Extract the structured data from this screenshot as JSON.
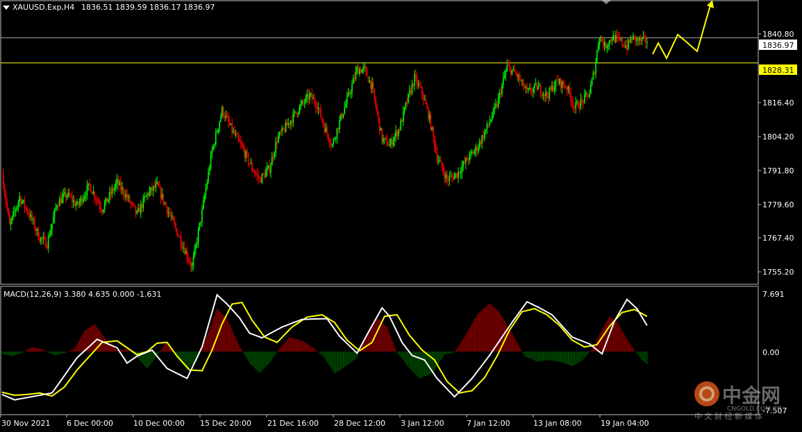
{
  "colors": {
    "background": "#000000",
    "frame": "#c0c0c0",
    "bull": "#00ff00",
    "bear": "#ff0000",
    "macd_line": "#ffffff",
    "signal_line": "#ffff00",
    "hist_pos": "#b40000",
    "hist_neg": "#006400",
    "current_price_line": "#a0a0a0",
    "level_line": "#ffff00",
    "forecast_arrow": "#ffff00"
  },
  "header": {
    "title": "XAUUSD.Exp,H4",
    "ohlc": "1836.51 1839.59 1836.17 1836.97"
  },
  "price_axis": {
    "ticks": [
      "1840.80",
      "1828.31",
      "1816.40",
      "1804.20",
      "1791.80",
      "1779.60",
      "1767.40",
      "1755.20"
    ],
    "current_price_label": "1836.97",
    "level_label": "1828.31"
  },
  "macd": {
    "label": "MACD(12,26,9) 3.380 4.635 0.000 -1.631",
    "axis_ticks": [
      "7.691",
      "0.00",
      "-7.507"
    ]
  },
  "time_axis": {
    "labels": [
      "30 Nov 2021",
      "6 Dec 00:00",
      "10 Dec 00:00",
      "15 Dec 20:00",
      "21 Dec 16:00",
      "28 Dec 12:00",
      "3 Jan 12:00",
      "7 Jan 12:00",
      "13 Jan 08:00",
      "19 Jan 04:00"
    ]
  },
  "watermark": {
    "brand": "中金网",
    "domain": "CNGOLD.COM.CN",
    "tagline": "中 文 财 经 新 媒 体"
  },
  "chart_data": [
    {
      "type": "candlestick",
      "title": "XAUUSD.Exp,H4",
      "ylim": [
        1752.0,
        1850.0
      ],
      "current_price": 1836.97,
      "horizontal_level": 1828.31,
      "anchors": [
        [
          0,
          1790
        ],
        [
          6,
          1772
        ],
        [
          14,
          1782
        ],
        [
          22,
          1776
        ],
        [
          30,
          1768
        ],
        [
          36,
          1766
        ],
        [
          44,
          1780
        ],
        [
          52,
          1783
        ],
        [
          60,
          1779
        ],
        [
          70,
          1786
        ],
        [
          80,
          1778
        ],
        [
          92,
          1787
        ],
        [
          100,
          1782
        ],
        [
          108,
          1776
        ],
        [
          116,
          1783
        ],
        [
          124,
          1786
        ],
        [
          132,
          1778
        ],
        [
          140,
          1770
        ],
        [
          146,
          1764
        ],
        [
          152,
          1758
        ],
        [
          160,
          1777
        ],
        [
          168,
          1798
        ],
        [
          176,
          1812
        ],
        [
          184,
          1805
        ],
        [
          192,
          1799
        ],
        [
          200,
          1792
        ],
        [
          206,
          1788
        ],
        [
          214,
          1792
        ],
        [
          220,
          1802
        ],
        [
          230,
          1808
        ],
        [
          238,
          1813
        ],
        [
          246,
          1817
        ],
        [
          252,
          1814
        ],
        [
          258,
          1806
        ],
        [
          264,
          1800
        ],
        [
          270,
          1808
        ],
        [
          278,
          1818
        ],
        [
          284,
          1826
        ],
        [
          290,
          1826
        ],
        [
          296,
          1820
        ],
        [
          304,
          1802
        ],
        [
          310,
          1800
        ],
        [
          318,
          1806
        ],
        [
          324,
          1815
        ],
        [
          330,
          1823
        ],
        [
          336,
          1818
        ],
        [
          342,
          1809
        ],
        [
          348,
          1796
        ],
        [
          356,
          1788
        ],
        [
          364,
          1790
        ],
        [
          372,
          1795
        ],
        [
          380,
          1799
        ],
        [
          388,
          1806
        ],
        [
          396,
          1814
        ],
        [
          404,
          1827
        ],
        [
          412,
          1824
        ],
        [
          420,
          1818
        ],
        [
          428,
          1820
        ],
        [
          436,
          1817
        ],
        [
          444,
          1822
        ],
        [
          452,
          1820
        ],
        [
          458,
          1813
        ],
        [
          464,
          1815
        ],
        [
          470,
          1818
        ],
        [
          474,
          1826
        ],
        [
          478,
          1838
        ],
        [
          482,
          1834
        ],
        [
          488,
          1837
        ],
        [
          494,
          1836
        ],
        [
          500,
          1834
        ],
        [
          504,
          1837
        ],
        [
          510,
          1836
        ]
      ]
    },
    {
      "type": "line",
      "title": "MACD(12,26,9)",
      "values_shown": [
        3.38,
        4.635,
        0.0,
        -1.631
      ],
      "ylim": [
        -7.507,
        7.691
      ],
      "series": [
        {
          "name": "MACD",
          "anchors": [
            [
              0,
              -5.6
            ],
            [
              10,
              -6.3
            ],
            [
              20,
              -6.0
            ],
            [
              40,
              -5.4
            ],
            [
              60,
              -0.8
            ],
            [
              76,
              1.6
            ],
            [
              92,
              0.5
            ],
            [
              100,
              -1.5
            ],
            [
              108,
              -0.6
            ],
            [
              120,
              0.2
            ],
            [
              132,
              -2.2
            ],
            [
              148,
              -3.5
            ],
            [
              160,
              0.6
            ],
            [
              172,
              7.4
            ],
            [
              180,
              6.2
            ],
            [
              190,
              4.4
            ],
            [
              198,
              2.4
            ],
            [
              208,
              1.8
            ],
            [
              224,
              3.2
            ],
            [
              240,
              4.2
            ],
            [
              260,
              4.3
            ],
            [
              270,
              2.0
            ],
            [
              284,
              -0.2
            ],
            [
              294,
              2.8
            ],
            [
              304,
              5.7
            ],
            [
              310,
              4.6
            ],
            [
              320,
              1.2
            ],
            [
              328,
              -0.5
            ],
            [
              338,
              -1.1
            ],
            [
              348,
              -3.5
            ],
            [
              362,
              -5.9
            ],
            [
              376,
              -3.5
            ],
            [
              390,
              -0.5
            ],
            [
              408,
              3.8
            ],
            [
              420,
              6.5
            ],
            [
              430,
              5.7
            ],
            [
              440,
              4.8
            ],
            [
              456,
              1.9
            ],
            [
              470,
              1.0
            ],
            [
              480,
              -0.3
            ],
            [
              490,
              4.0
            ],
            [
              500,
              6.8
            ],
            [
              508,
              5.6
            ],
            [
              516,
              3.4
            ]
          ]
        },
        {
          "name": "Signal",
          "anchors": [
            [
              0,
              -5.3
            ],
            [
              10,
              -5.7
            ],
            [
              20,
              -5.6
            ],
            [
              30,
              -5.4
            ],
            [
              40,
              -5.8
            ],
            [
              50,
              -4.6
            ],
            [
              60,
              -2.4
            ],
            [
              70,
              -0.6
            ],
            [
              80,
              1.2
            ],
            [
              92,
              1.4
            ],
            [
              100,
              0.5
            ],
            [
              108,
              -0.4
            ],
            [
              116,
              0.0
            ],
            [
              124,
              1.1
            ],
            [
              132,
              1.2
            ],
            [
              140,
              -0.6
            ],
            [
              150,
              -2.4
            ],
            [
              160,
              -2.5
            ],
            [
              168,
              0.2
            ],
            [
              176,
              3.6
            ],
            [
              184,
              6.2
            ],
            [
              192,
              6.4
            ],
            [
              200,
              4.1
            ],
            [
              210,
              1.9
            ],
            [
              220,
              1.2
            ],
            [
              232,
              3.2
            ],
            [
              244,
              4.5
            ],
            [
              256,
              4.8
            ],
            [
              266,
              3.8
            ],
            [
              276,
              1.5
            ],
            [
              286,
              0.1
            ],
            [
              296,
              1.2
            ],
            [
              306,
              4.6
            ],
            [
              316,
              4.8
            ],
            [
              326,
              2.1
            ],
            [
              336,
              0.2
            ],
            [
              346,
              -1.1
            ],
            [
              356,
              -3.9
            ],
            [
              366,
              -5.4
            ],
            [
              376,
              -5.1
            ],
            [
              386,
              -3.4
            ],
            [
              396,
              -0.6
            ],
            [
              406,
              2.8
            ],
            [
              416,
              5.2
            ],
            [
              426,
              5.6
            ],
            [
              436,
              4.8
            ],
            [
              446,
              3.4
            ],
            [
              456,
              1.5
            ],
            [
              466,
              0.6
            ],
            [
              476,
              0.9
            ],
            [
              486,
              3.3
            ],
            [
              496,
              5.1
            ],
            [
              506,
              5.5
            ],
            [
              516,
              4.6
            ]
          ]
        }
      ],
      "histogram_anchors": [
        [
          0,
          -0.3
        ],
        [
          8,
          -0.6
        ],
        [
          16,
          -0.2
        ],
        [
          24,
          0.6
        ],
        [
          32,
          0.3
        ],
        [
          42,
          -0.5
        ],
        [
          50,
          -0.2
        ],
        [
          58,
          0.4
        ],
        [
          66,
          2.7
        ],
        [
          74,
          3.6
        ],
        [
          84,
          1.4
        ],
        [
          92,
          0.2
        ],
        [
          100,
          0.3
        ],
        [
          108,
          -0.7
        ],
        [
          116,
          -2.2
        ],
        [
          124,
          -0.6
        ],
        [
          132,
          1.4
        ],
        [
          140,
          -0.8
        ],
        [
          148,
          -2.4
        ],
        [
          156,
          -1.2
        ],
        [
          164,
          2.1
        ],
        [
          172,
          5.6
        ],
        [
          180,
          4.3
        ],
        [
          190,
          0.7
        ],
        [
          198,
          -1.5
        ],
        [
          206,
          -2.8
        ],
        [
          214,
          -1.5
        ],
        [
          222,
          0.4
        ],
        [
          230,
          1.9
        ],
        [
          240,
          1.4
        ],
        [
          250,
          0.4
        ],
        [
          258,
          -0.8
        ],
        [
          266,
          -2.9
        ],
        [
          276,
          -1.8
        ],
        [
          284,
          -0.8
        ],
        [
          292,
          2.4
        ],
        [
          300,
          4.5
        ],
        [
          308,
          3.2
        ],
        [
          316,
          -0.1
        ],
        [
          326,
          -2.2
        ],
        [
          334,
          -3.5
        ],
        [
          344,
          -2.9
        ],
        [
          354,
          -0.4
        ],
        [
          362,
          -0.1
        ],
        [
          370,
          1.9
        ],
        [
          380,
          4.8
        ],
        [
          390,
          6.3
        ],
        [
          398,
          5.1
        ],
        [
          408,
          2.4
        ],
        [
          418,
          -0.6
        ],
        [
          428,
          -1.3
        ],
        [
          438,
          -1.1
        ],
        [
          448,
          -1.4
        ],
        [
          456,
          -1.9
        ],
        [
          464,
          -1.2
        ],
        [
          472,
          0.3
        ],
        [
          480,
          2.9
        ],
        [
          486,
          4.6
        ],
        [
          492,
          3.9
        ],
        [
          500,
          1.6
        ],
        [
          506,
          0.2
        ],
        [
          512,
          -1.1
        ],
        [
          516,
          -1.6
        ]
      ]
    }
  ]
}
